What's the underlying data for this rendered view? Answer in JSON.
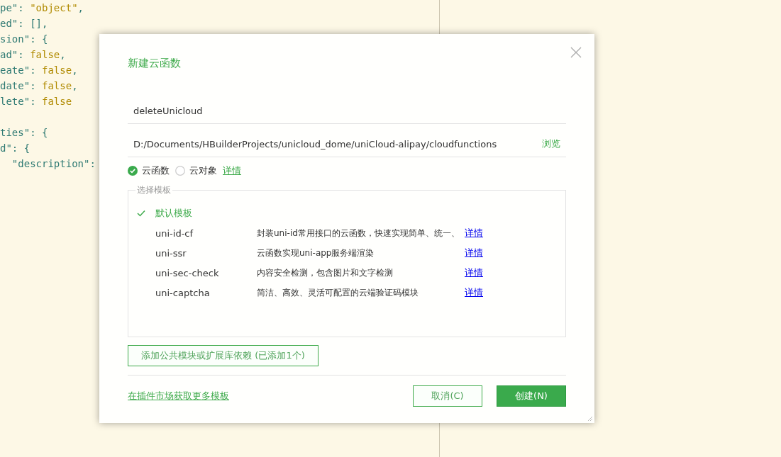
{
  "editor": {
    "lines": [
      [
        {
          "kind": "key",
          "text": "pe\": "
        },
        {
          "kind": "string",
          "text": "\"object\""
        },
        {
          "kind": "punct",
          "text": ","
        }
      ],
      [
        {
          "kind": "key",
          "text": "ed\": [],"
        }
      ],
      [
        {
          "kind": "key",
          "text": "sion\": {"
        }
      ],
      [
        {
          "kind": "key",
          "text": "ad\": "
        },
        {
          "kind": "value",
          "text": "false"
        },
        {
          "kind": "punct",
          "text": ","
        }
      ],
      [
        {
          "kind": "key",
          "text": "eate\": "
        },
        {
          "kind": "value",
          "text": "false"
        },
        {
          "kind": "punct",
          "text": ","
        }
      ],
      [
        {
          "kind": "key",
          "text": "date\": "
        },
        {
          "kind": "value",
          "text": "false"
        },
        {
          "kind": "punct",
          "text": ","
        }
      ],
      [
        {
          "kind": "key",
          "text": "lete\": "
        },
        {
          "kind": "value",
          "text": "false"
        }
      ],
      [
        {
          "kind": "key",
          "text": "ties\": {"
        }
      ],
      [
        {
          "kind": "key",
          "text": "d\": {"
        }
      ],
      [
        {
          "kind": "key",
          "text": "  \"description\":"
        }
      ]
    ]
  },
  "dialog": {
    "title": "新建云函数",
    "name_field": {
      "value": "deleteUnicloud"
    },
    "path_field": {
      "value": "D:/Documents/HBuilderProjects/unicloud_dome/uniCloud-alipay/cloudfunctions",
      "action": "浏览"
    },
    "types": [
      {
        "label": "云函数",
        "selected": true
      },
      {
        "label": "云对象",
        "selected": false
      }
    ],
    "types_link": "详情",
    "templates": {
      "legend": "选择模板",
      "items": [
        {
          "name": "默认模板",
          "selected": true
        },
        {
          "name": "uni-id-cf",
          "description": "封装uni-id常用接口的云函数，快速实现简单、统一、",
          "link": "详情",
          "selected": false
        },
        {
          "name": "uni-ssr",
          "description": "云函数实现uni-app服务端渲染",
          "link": "详情",
          "selected": false
        },
        {
          "name": "uni-sec-check",
          "description": "内容安全检测，包含图片和文字检测",
          "link": "详情",
          "selected": false
        },
        {
          "name": "uni-captcha",
          "description": "简洁、高效、灵活可配置的云端验证码模块",
          "link": "详情",
          "selected": false
        }
      ]
    },
    "add_dependency_button": "添加公共模块或扩展库依赖 (已添加1个)",
    "market_link": "在插件市场获取更多模板",
    "buttons": [
      {
        "label": "取消(C)",
        "kind": "secondary"
      },
      {
        "label": "创建(N)",
        "kind": "primary"
      }
    ]
  }
}
